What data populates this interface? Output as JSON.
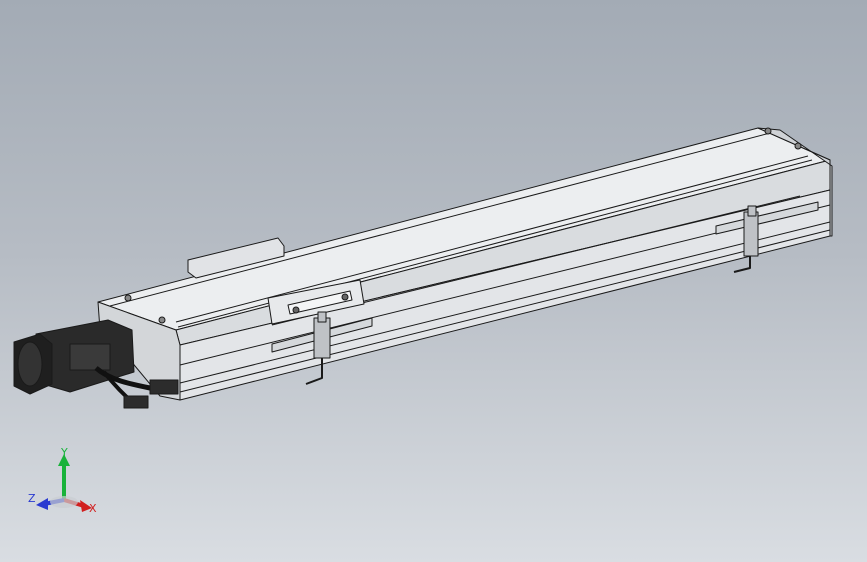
{
  "view": {
    "background_top": "#a3abb5",
    "background_bottom": "#d9dde2"
  },
  "triad": {
    "x_label": "X",
    "y_label": "Y",
    "z_label": "Z",
    "x_color": "#d11f1f",
    "y_color": "#18b23a",
    "z_color": "#2a3ad0"
  },
  "model": {
    "name": "linear-actuator",
    "body_color": "#e7e9eb",
    "edge_color": "#1a1a1a",
    "motor_color": "#222222"
  }
}
